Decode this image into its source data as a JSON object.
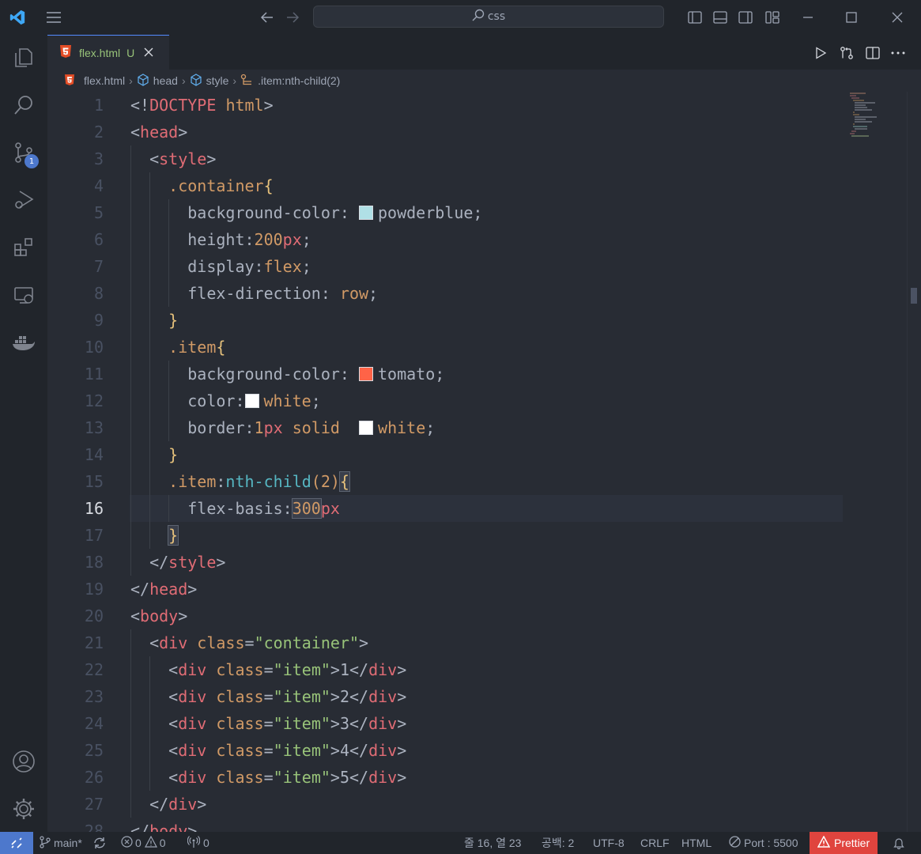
{
  "titlebar": {
    "search_text": "css"
  },
  "activity": {
    "scm_badge": "1"
  },
  "tab": {
    "file": "flex.html",
    "status": "U"
  },
  "breadcrumb": {
    "file": "flex.html",
    "b1": "head",
    "b2": "style",
    "b3": ".item:nth-child(2)"
  },
  "editor": {
    "current_line": 16,
    "lines": [
      [
        [
          "t-p",
          "<!"
        ],
        [
          "t-r",
          "DOCTYPE"
        ],
        [
          "t-p",
          " "
        ],
        [
          "t-o",
          "html"
        ],
        [
          "t-p",
          ">"
        ]
      ],
      [
        [
          "t-p",
          "<"
        ],
        [
          "t-r",
          "head"
        ],
        [
          "t-p",
          ">"
        ]
      ],
      [
        [
          "t-p",
          "  <"
        ],
        [
          "t-r",
          "style"
        ],
        [
          "t-p",
          ">"
        ]
      ],
      [
        [
          "t-o",
          "    .container"
        ],
        [
          "t-y",
          "{"
        ]
      ],
      [
        [
          "t-p",
          "      background-color: "
        ],
        [
          "sw",
          "#b0e0e6"
        ],
        [
          "t-p",
          "powderblue;"
        ]
      ],
      [
        [
          "t-p",
          "      height:"
        ],
        [
          "t-o",
          "200"
        ],
        [
          "t-r",
          "px"
        ],
        [
          "t-p",
          ";"
        ]
      ],
      [
        [
          "t-p",
          "      display:"
        ],
        [
          "t-o",
          "flex"
        ],
        [
          "t-p",
          ";"
        ]
      ],
      [
        [
          "t-p",
          "      flex-direction: "
        ],
        [
          "t-o",
          "row"
        ],
        [
          "t-p",
          ";"
        ]
      ],
      [
        [
          "t-y",
          "    }"
        ]
      ],
      [
        [
          "t-o",
          "    .item"
        ],
        [
          "t-y",
          "{"
        ]
      ],
      [
        [
          "t-p",
          "      background-color: "
        ],
        [
          "sw",
          "#ff6347"
        ],
        [
          "t-p",
          "tomato;"
        ]
      ],
      [
        [
          "t-p",
          "      color:"
        ],
        [
          "sw",
          "#ffffff"
        ],
        [
          "t-o",
          "white"
        ],
        [
          "t-p",
          ";"
        ]
      ],
      [
        [
          "t-p",
          "      border:"
        ],
        [
          "t-o",
          "1"
        ],
        [
          "t-r",
          "px"
        ],
        [
          "t-p",
          " "
        ],
        [
          "t-o",
          "solid"
        ],
        [
          "t-p",
          "  "
        ],
        [
          "sw",
          "#ffffff"
        ],
        [
          "t-o",
          "white"
        ],
        [
          "t-p",
          ";"
        ]
      ],
      [
        [
          "t-y",
          "    }"
        ]
      ],
      [
        [
          "t-o",
          "    .item"
        ],
        [
          "t-p",
          ":"
        ],
        [
          "t-c",
          "nth-child"
        ],
        [
          "t-o",
          "(2)"
        ],
        [
          "bh",
          "{"
        ]
      ],
      [
        [
          "t-p",
          "      flex-basis:"
        ],
        [
          "bh",
          "300"
        ],
        [
          "t-r",
          "px"
        ]
      ],
      [
        [
          "t-p",
          "    "
        ],
        [
          "bh",
          "}"
        ]
      ],
      [
        [
          "t-p",
          "  </"
        ],
        [
          "t-r",
          "style"
        ],
        [
          "t-p",
          ">"
        ]
      ],
      [
        [
          "t-p",
          "</"
        ],
        [
          "t-r",
          "head"
        ],
        [
          "t-p",
          ">"
        ]
      ],
      [
        [
          "t-p",
          "<"
        ],
        [
          "t-r",
          "body"
        ],
        [
          "t-p",
          ">"
        ]
      ],
      [
        [
          "t-p",
          "  <"
        ],
        [
          "t-r",
          "div"
        ],
        [
          "t-p",
          " "
        ],
        [
          "t-o",
          "class"
        ],
        [
          "t-p",
          "="
        ],
        [
          "t-g",
          "\"container\""
        ],
        [
          "t-p",
          ">"
        ]
      ],
      [
        [
          "t-p",
          "    <"
        ],
        [
          "t-r",
          "div"
        ],
        [
          "t-p",
          " "
        ],
        [
          "t-o",
          "class"
        ],
        [
          "t-p",
          "="
        ],
        [
          "t-g",
          "\"item\""
        ],
        [
          "t-p",
          ">1</"
        ],
        [
          "t-r",
          "div"
        ],
        [
          "t-p",
          ">"
        ]
      ],
      [
        [
          "t-p",
          "    <"
        ],
        [
          "t-r",
          "div"
        ],
        [
          "t-p",
          " "
        ],
        [
          "t-o",
          "class"
        ],
        [
          "t-p",
          "="
        ],
        [
          "t-g",
          "\"item\""
        ],
        [
          "t-p",
          ">2</"
        ],
        [
          "t-r",
          "div"
        ],
        [
          "t-p",
          ">"
        ]
      ],
      [
        [
          "t-p",
          "    <"
        ],
        [
          "t-r",
          "div"
        ],
        [
          "t-p",
          " "
        ],
        [
          "t-o",
          "class"
        ],
        [
          "t-p",
          "="
        ],
        [
          "t-g",
          "\"item\""
        ],
        [
          "t-p",
          ">3</"
        ],
        [
          "t-r",
          "div"
        ],
        [
          "t-p",
          ">"
        ]
      ],
      [
        [
          "t-p",
          "    <"
        ],
        [
          "t-r",
          "div"
        ],
        [
          "t-p",
          " "
        ],
        [
          "t-o",
          "class"
        ],
        [
          "t-p",
          "="
        ],
        [
          "t-g",
          "\"item\""
        ],
        [
          "t-p",
          ">4</"
        ],
        [
          "t-r",
          "div"
        ],
        [
          "t-p",
          ">"
        ]
      ],
      [
        [
          "t-p",
          "    <"
        ],
        [
          "t-r",
          "div"
        ],
        [
          "t-p",
          " "
        ],
        [
          "t-o",
          "class"
        ],
        [
          "t-p",
          "="
        ],
        [
          "t-g",
          "\"item\""
        ],
        [
          "t-p",
          ">5</"
        ],
        [
          "t-r",
          "div"
        ],
        [
          "t-p",
          ">"
        ]
      ],
      [
        [
          "t-p",
          "  </"
        ],
        [
          "t-r",
          "div"
        ],
        [
          "t-p",
          ">"
        ]
      ],
      [
        [
          "t-p",
          "</"
        ],
        [
          "t-r",
          "body"
        ],
        [
          "t-p",
          ">"
        ]
      ]
    ]
  },
  "status": {
    "branch": "main*",
    "errors": "0",
    "warnings": "0",
    "ports": "0",
    "position": "줄 16, 열 23",
    "spaces": "공백: 2",
    "encoding": "UTF-8",
    "eol": "CRLF",
    "language": "HTML",
    "port": "Port : 5500",
    "prettier": "Prettier"
  },
  "colors": {
    "accent": "#4d78cc",
    "error": "#e0443e",
    "html_icon": "#e44d26"
  }
}
